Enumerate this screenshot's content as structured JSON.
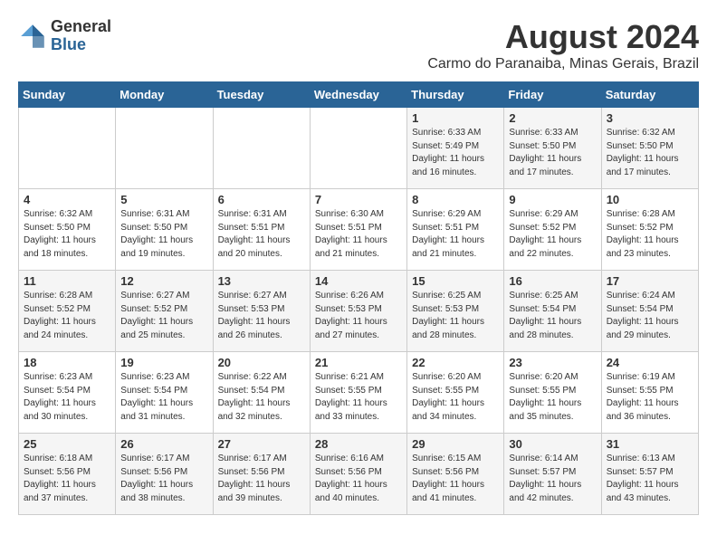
{
  "header": {
    "logo_general": "General",
    "logo_blue": "Blue",
    "month_title": "August 2024",
    "location": "Carmo do Paranaiba, Minas Gerais, Brazil"
  },
  "days_of_week": [
    "Sunday",
    "Monday",
    "Tuesday",
    "Wednesday",
    "Thursday",
    "Friday",
    "Saturday"
  ],
  "weeks": [
    [
      {
        "day": "",
        "info": ""
      },
      {
        "day": "",
        "info": ""
      },
      {
        "day": "",
        "info": ""
      },
      {
        "day": "",
        "info": ""
      },
      {
        "day": "1",
        "info": "Sunrise: 6:33 AM\nSunset: 5:49 PM\nDaylight: 11 hours and 16 minutes."
      },
      {
        "day": "2",
        "info": "Sunrise: 6:33 AM\nSunset: 5:50 PM\nDaylight: 11 hours and 17 minutes."
      },
      {
        "day": "3",
        "info": "Sunrise: 6:32 AM\nSunset: 5:50 PM\nDaylight: 11 hours and 17 minutes."
      }
    ],
    [
      {
        "day": "4",
        "info": "Sunrise: 6:32 AM\nSunset: 5:50 PM\nDaylight: 11 hours and 18 minutes."
      },
      {
        "day": "5",
        "info": "Sunrise: 6:31 AM\nSunset: 5:50 PM\nDaylight: 11 hours and 19 minutes."
      },
      {
        "day": "6",
        "info": "Sunrise: 6:31 AM\nSunset: 5:51 PM\nDaylight: 11 hours and 20 minutes."
      },
      {
        "day": "7",
        "info": "Sunrise: 6:30 AM\nSunset: 5:51 PM\nDaylight: 11 hours and 21 minutes."
      },
      {
        "day": "8",
        "info": "Sunrise: 6:29 AM\nSunset: 5:51 PM\nDaylight: 11 hours and 21 minutes."
      },
      {
        "day": "9",
        "info": "Sunrise: 6:29 AM\nSunset: 5:52 PM\nDaylight: 11 hours and 22 minutes."
      },
      {
        "day": "10",
        "info": "Sunrise: 6:28 AM\nSunset: 5:52 PM\nDaylight: 11 hours and 23 minutes."
      }
    ],
    [
      {
        "day": "11",
        "info": "Sunrise: 6:28 AM\nSunset: 5:52 PM\nDaylight: 11 hours and 24 minutes."
      },
      {
        "day": "12",
        "info": "Sunrise: 6:27 AM\nSunset: 5:52 PM\nDaylight: 11 hours and 25 minutes."
      },
      {
        "day": "13",
        "info": "Sunrise: 6:27 AM\nSunset: 5:53 PM\nDaylight: 11 hours and 26 minutes."
      },
      {
        "day": "14",
        "info": "Sunrise: 6:26 AM\nSunset: 5:53 PM\nDaylight: 11 hours and 27 minutes."
      },
      {
        "day": "15",
        "info": "Sunrise: 6:25 AM\nSunset: 5:53 PM\nDaylight: 11 hours and 28 minutes."
      },
      {
        "day": "16",
        "info": "Sunrise: 6:25 AM\nSunset: 5:54 PM\nDaylight: 11 hours and 28 minutes."
      },
      {
        "day": "17",
        "info": "Sunrise: 6:24 AM\nSunset: 5:54 PM\nDaylight: 11 hours and 29 minutes."
      }
    ],
    [
      {
        "day": "18",
        "info": "Sunrise: 6:23 AM\nSunset: 5:54 PM\nDaylight: 11 hours and 30 minutes."
      },
      {
        "day": "19",
        "info": "Sunrise: 6:23 AM\nSunset: 5:54 PM\nDaylight: 11 hours and 31 minutes."
      },
      {
        "day": "20",
        "info": "Sunrise: 6:22 AM\nSunset: 5:54 PM\nDaylight: 11 hours and 32 minutes."
      },
      {
        "day": "21",
        "info": "Sunrise: 6:21 AM\nSunset: 5:55 PM\nDaylight: 11 hours and 33 minutes."
      },
      {
        "day": "22",
        "info": "Sunrise: 6:20 AM\nSunset: 5:55 PM\nDaylight: 11 hours and 34 minutes."
      },
      {
        "day": "23",
        "info": "Sunrise: 6:20 AM\nSunset: 5:55 PM\nDaylight: 11 hours and 35 minutes."
      },
      {
        "day": "24",
        "info": "Sunrise: 6:19 AM\nSunset: 5:55 PM\nDaylight: 11 hours and 36 minutes."
      }
    ],
    [
      {
        "day": "25",
        "info": "Sunrise: 6:18 AM\nSunset: 5:56 PM\nDaylight: 11 hours and 37 minutes."
      },
      {
        "day": "26",
        "info": "Sunrise: 6:17 AM\nSunset: 5:56 PM\nDaylight: 11 hours and 38 minutes."
      },
      {
        "day": "27",
        "info": "Sunrise: 6:17 AM\nSunset: 5:56 PM\nDaylight: 11 hours and 39 minutes."
      },
      {
        "day": "28",
        "info": "Sunrise: 6:16 AM\nSunset: 5:56 PM\nDaylight: 11 hours and 40 minutes."
      },
      {
        "day": "29",
        "info": "Sunrise: 6:15 AM\nSunset: 5:56 PM\nDaylight: 11 hours and 41 minutes."
      },
      {
        "day": "30",
        "info": "Sunrise: 6:14 AM\nSunset: 5:57 PM\nDaylight: 11 hours and 42 minutes."
      },
      {
        "day": "31",
        "info": "Sunrise: 6:13 AM\nSunset: 5:57 PM\nDaylight: 11 hours and 43 minutes."
      }
    ]
  ]
}
